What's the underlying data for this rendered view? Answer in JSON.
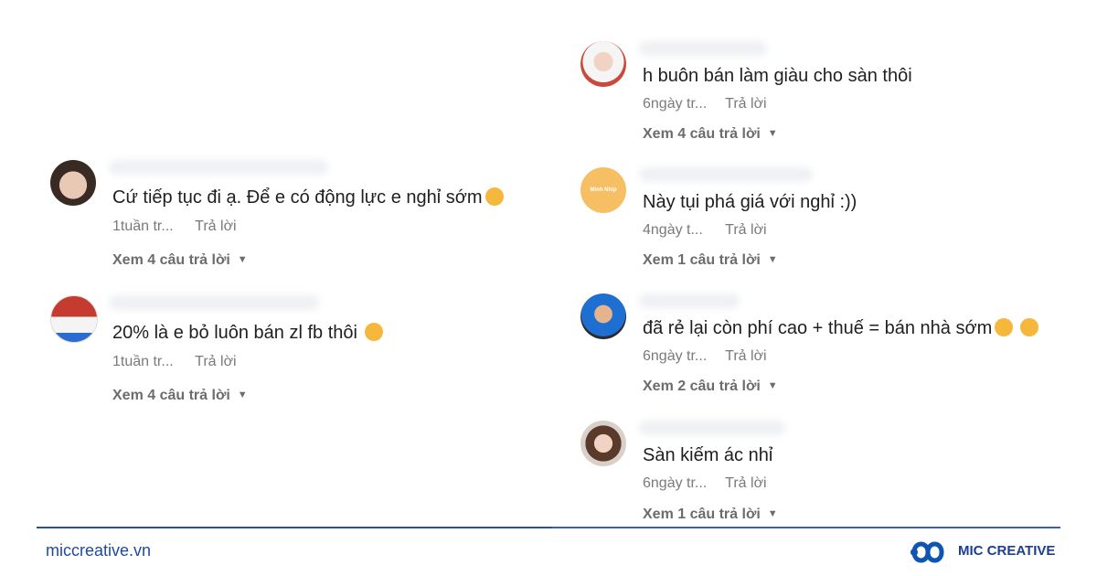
{
  "comments_left": [
    {
      "text": "Cứ tiếp tục đi ạ. Để e có động lực e nghỉ sớm",
      "emoji": "rofl-emoji",
      "time": "1tuần tr...",
      "reply": "Trả lời",
      "view": "Xem 4 câu trả lời"
    },
    {
      "text": "20% là e bỏ luôn bán zl fb thôi",
      "emoji": "grin-emoji",
      "time": "1tuần tr...",
      "reply": "Trả lời",
      "view": "Xem 4 câu trả lời"
    }
  ],
  "comments_right": [
    {
      "text": "h buôn bán làm giàu cho sàn thôi",
      "time": "6ngày tr...",
      "reply": "Trả lời",
      "view": "Xem 4 câu trả lời"
    },
    {
      "text": "Này tụi phá giá với nghỉ :))",
      "avatar_text": "Minh Nhip",
      "time": "4ngày t...",
      "reply": "Trả lời",
      "view": "Xem 1 câu trả lời"
    },
    {
      "text": "đã rẻ lại còn phí cao + thuế = bán nhà sớm",
      "emoji": "joy-emoji",
      "time": "6ngày tr...",
      "reply": "Trả lời",
      "view": "Xem 2 câu trả lời"
    },
    {
      "text": "Sàn kiếm ác nhỉ",
      "time": "6ngày tr...",
      "reply": "Trả lời",
      "view": "Xem 1 câu trả lời"
    }
  ],
  "footer": {
    "site": "miccreative.vn",
    "brand": "MIC CREATIVE"
  },
  "colors": {
    "accent": "#1b3f94",
    "footer_line": "#2f4f8f",
    "meta_text": "#7a7a7a"
  }
}
